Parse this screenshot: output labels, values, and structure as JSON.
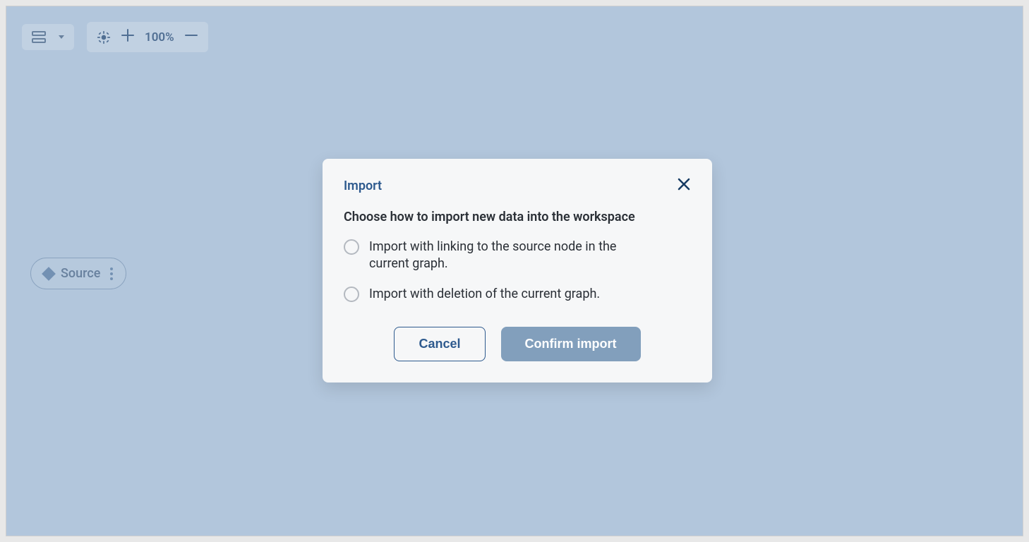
{
  "toolbar": {
    "zoom_level": "100%"
  },
  "canvas": {
    "source_node_label": "Source"
  },
  "modal": {
    "title": "Import",
    "subtitle": "Choose how to import new data into the workspace",
    "options": [
      {
        "label": "Import with linking to the source node in the current graph."
      },
      {
        "label": "Import with deletion of the current graph."
      }
    ],
    "cancel_label": "Cancel",
    "confirm_label": "Confirm import"
  },
  "icons": {
    "layout": "layout-icon",
    "target": "target-icon",
    "plus": "plus-icon",
    "minus": "minus-icon",
    "close": "close-icon",
    "kebab": "kebab-icon",
    "diamond": "diamond-icon"
  }
}
